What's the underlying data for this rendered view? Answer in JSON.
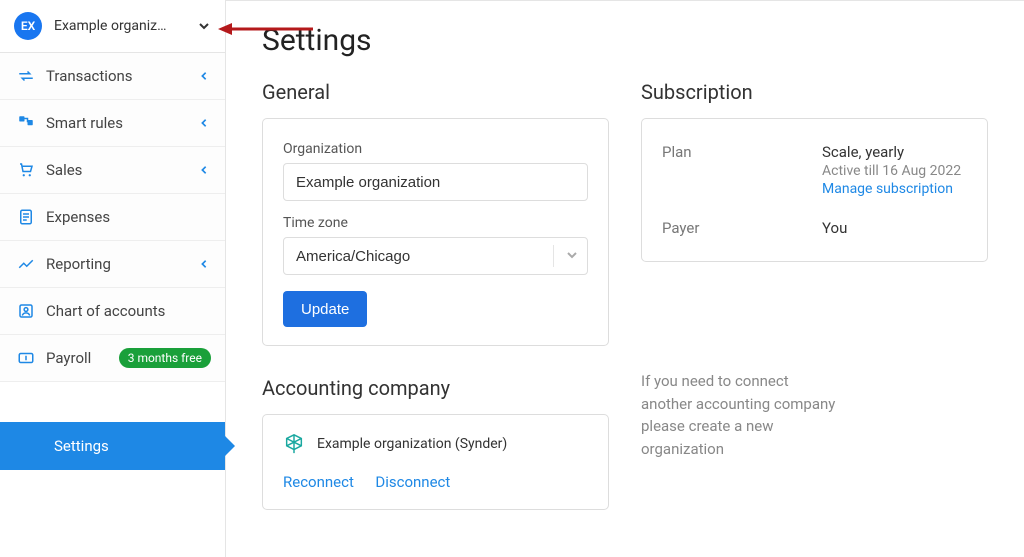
{
  "org": {
    "avatar_initials": "EX",
    "name": "Example organiz…"
  },
  "sidebar": {
    "items": [
      {
        "label": "Transactions"
      },
      {
        "label": "Smart rules"
      },
      {
        "label": "Sales"
      },
      {
        "label": "Expenses"
      },
      {
        "label": "Reporting"
      },
      {
        "label": "Chart of accounts"
      },
      {
        "label": "Payroll",
        "badge": "3 months free"
      }
    ],
    "settings_label": "Settings"
  },
  "page": {
    "title": "Settings"
  },
  "general": {
    "heading": "General",
    "org_label": "Organization",
    "org_value": "Example organization",
    "tz_label": "Time zone",
    "tz_value": "America/Chicago",
    "update_label": "Update"
  },
  "subscription": {
    "heading": "Subscription",
    "plan_label": "Plan",
    "plan_value": "Scale, yearly",
    "plan_meta": "Active till 16 Aug 2022",
    "manage_link": "Manage subscription",
    "payer_label": "Payer",
    "payer_value": "You"
  },
  "accounting": {
    "heading": "Accounting company",
    "company": "Example organization (Synder)",
    "reconnect": "Reconnect",
    "disconnect": "Disconnect",
    "help": "If you need to connect another accounting company please create a new organization"
  }
}
